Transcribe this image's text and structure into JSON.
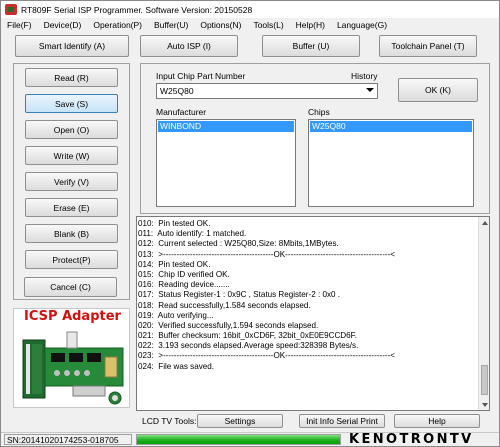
{
  "window": {
    "title": "RT809F Serial ISP Programmer. Software Version: 20150528"
  },
  "menu": [
    "File(F)",
    "Device(D)",
    "Operation(P)",
    "Buffer(U)",
    "Options(N)",
    "Tools(L)",
    "Help(H)",
    "Language(G)"
  ],
  "toolbar": {
    "smart_identify": "Smart Identify (A)",
    "auto_isp": "Auto ISP (I)",
    "buffer": "Buffer (U)",
    "toolchain_panel": "Toolchain Panel (T)"
  },
  "operations": [
    "Read (R)",
    "Save (S)",
    "Open (O)",
    "Write (W)",
    "Verify (V)",
    "Erase (E)",
    "Blank (B)",
    "Protect(P)"
  ],
  "cancel_label": "Cancel (C)",
  "chip": {
    "part_number_label": "Input Chip Part Number",
    "history_label": "History",
    "part_number_value": "W25Q80",
    "ok_label": "OK (K)",
    "manufacturer_label": "Manufacturer",
    "manufacturer_selected": "WINBOND",
    "chips_label": "Chips",
    "chips_selected": "W25Q80"
  },
  "log_lines": [
    "010:  Pin tested OK.",
    "011:  Auto identify: 1 matched.",
    "012:  Current selected : W25Q80,Size: 8Mbits,1MBytes.",
    "013:  >-----------------------------------------OK---------------------------------------<",
    "014:  Pin tested OK.",
    "015:  Chip ID verified OK.",
    "016:  Reading device.......",
    "017:  Status Register-1 : 0x9C , Status Register-2 : 0x0 .",
    "018:  Read successfully,1.584 seconds elapsed.",
    "019:  Auto verifying...",
    "020:  Verified successfully,1.594 seconds elapsed.",
    "021:  Buffer checksum: 16bit_0xCD6F, 32bit_0xE0E9CCD6F.",
    "022:  3.193 seconds elapsed.Average speed:328398 Bytes/s.",
    "023:  >-----------------------------------------OK---------------------------------------<",
    "024:  File was saved."
  ],
  "adapter": {
    "title": "ICSP Adapter"
  },
  "bottom": {
    "lcd_label": "LCD TV Tools:",
    "settings": "Settings",
    "init_info": "Init Info Serial Print",
    "help": "Help"
  },
  "status": {
    "serial_number": "SN:20141020174253-018705",
    "progress_fraction": 1.0,
    "watermark": "KENOTRONTV"
  }
}
